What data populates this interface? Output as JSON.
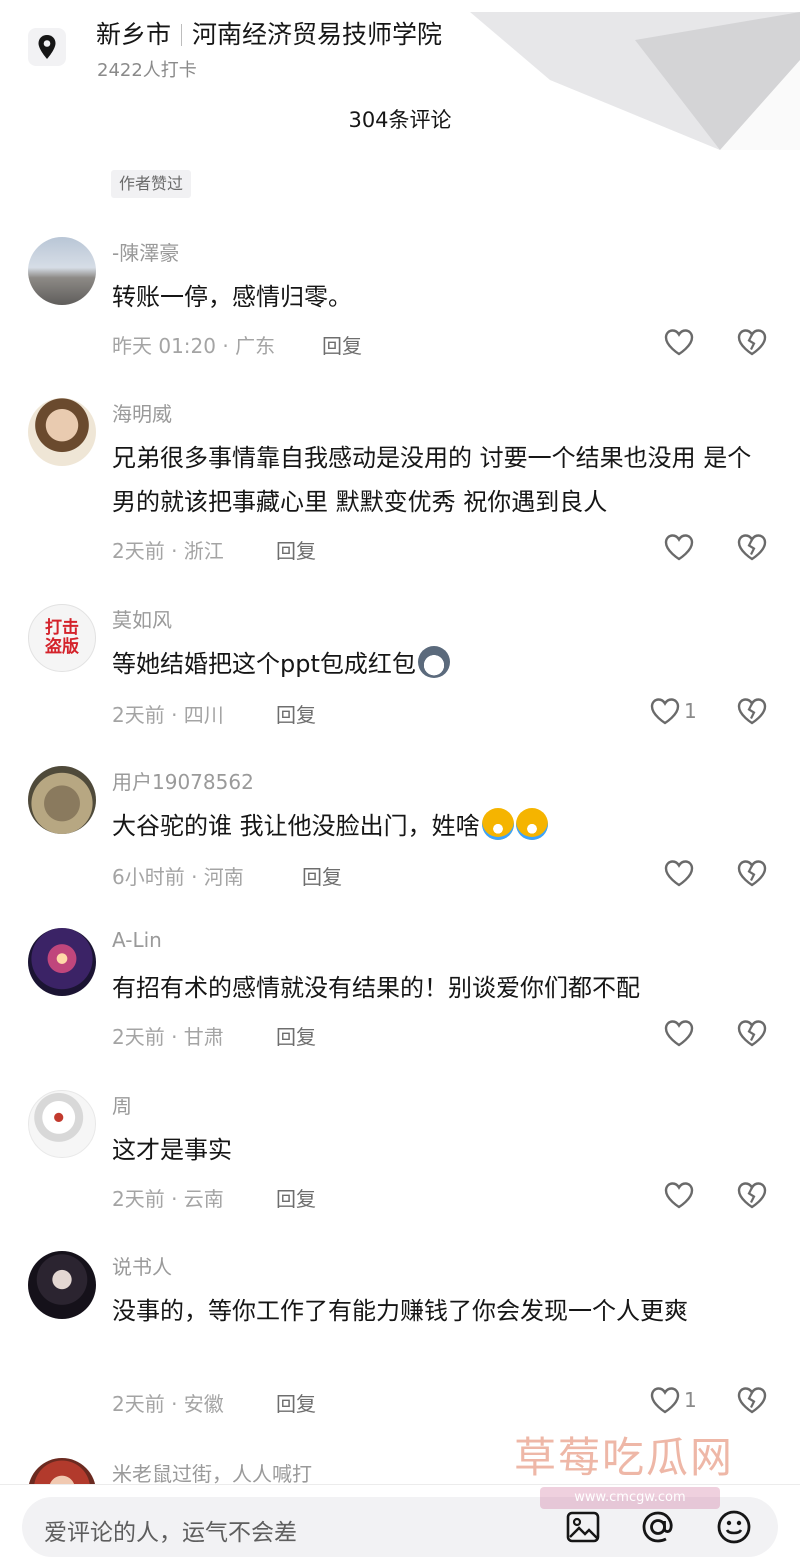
{
  "location": {
    "city": "新乡市",
    "place": "河南经济贸易技师学院",
    "checkins": "2422人打卡"
  },
  "comments_total": "304条评论",
  "author_liked_badge": "作者赞过",
  "comments": [
    {
      "user": "-陳澤豪",
      "text": "转账一停，感情归零。",
      "time_region": "昨天 01:20 · 广东",
      "reply": "回复",
      "likes": ""
    },
    {
      "user": "海明威",
      "text": "兄弟很多事情靠自我感动是没用的 讨要一个结果也没用 是个男的就该把事藏心里 默默变优秀 祝你遇到良人",
      "time_region": "2天前 · 浙江",
      "reply": "回复",
      "likes": ""
    },
    {
      "user": "莫如风",
      "text": "等她结婚把这个ppt包成红包",
      "time_region": "2天前 · 四川",
      "reply": "回复",
      "likes": "1"
    },
    {
      "user": "用户19078562",
      "text": "大谷驼的谁 我让他没脸出门，姓啥",
      "time_region": "6小时前 · 河南",
      "reply": "回复",
      "likes": ""
    },
    {
      "user": "A-Lin",
      "text": "有招有术的感情就没有结果的！别谈爱你们都不配",
      "time_region": "2天前 · 甘肃",
      "reply": "回复",
      "likes": ""
    },
    {
      "user": "周",
      "text": "这才是事实",
      "time_region": "2天前 · 云南",
      "reply": "回复",
      "likes": ""
    },
    {
      "user": "说书人",
      "text": "没事的，等你工作了有能力赚钱了你会发现一个人更爽",
      "time_region": "2天前 · 安徽",
      "reply": "回复",
      "likes": "1"
    },
    {
      "user": "米老鼠过街，人人喊打",
      "text": "",
      "time_region": "",
      "reply": "",
      "likes": ""
    }
  ],
  "avatar_text_3": "打击盗版",
  "input": {
    "placeholder": "爱评论的人，运气不会差"
  },
  "watermark": {
    "main": "草莓吃瓜网",
    "sub": "www.cmcgw.com"
  },
  "icons": {
    "location": "location-pin-icon",
    "like": "heart-icon",
    "dislike": "broken-heart-icon",
    "image": "image-icon",
    "mention": "at-icon",
    "emoji": "smiley-icon"
  }
}
